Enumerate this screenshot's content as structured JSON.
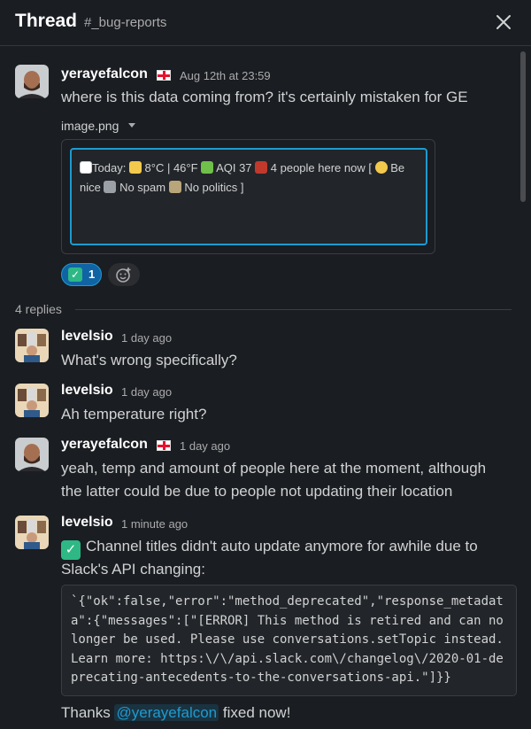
{
  "header": {
    "title": "Thread",
    "channel": "#_bug-reports"
  },
  "colors": {
    "accent": "#1d9bd1",
    "background": "#1a1d21",
    "success": "#2eb886",
    "reaction_bg": "#1164a3"
  },
  "parent": {
    "author": "yerayefalcon",
    "timestamp": "Aug 12th at 23:59",
    "text": "where is this data coming from? it's certainly mistaken for GE",
    "attachment": {
      "filename": "image.png",
      "preview_text": "Today: 8°C | 46°F AQI 37 4 people here now [ Be nice No spam No politics ]"
    },
    "reactions": [
      {
        "emoji": "white_check_mark",
        "count": "1"
      }
    ]
  },
  "replies_label": "4 replies",
  "messages": [
    {
      "author": "levelsio",
      "timestamp": "1 day ago",
      "text": "What's wrong specifically?"
    },
    {
      "author": "levelsio",
      "timestamp": "1 day ago",
      "text": "Ah temperature right?"
    },
    {
      "author": "yerayefalcon",
      "timestamp": "1 day ago",
      "text_line1": "yeah, temp and amount of people here at the moment, although",
      "text_line2": "the latter could be due to people not updating their location"
    },
    {
      "author": "levelsio",
      "timestamp": "1 minute ago",
      "text_line1": "Channel titles didn't auto update anymore for awhile due to",
      "text_line2": "Slack's API changing:",
      "code": "`{\"ok\":false,\"error\":\"method_deprecated\",\"response_metadata\":{\"messages\":[\"[ERROR] This method is retired and can no longer be used. Please use conversations.setTopic instead. Learn more: https:\\/\\/api.slack.com\\/changelog\\/2020-01-deprecating-antecedents-to-the-conversations-api.\"]}}",
      "thanks_prefix": "Thanks",
      "mention": "@yerayefalcon",
      "thanks_suffix": "fixed now!"
    }
  ]
}
